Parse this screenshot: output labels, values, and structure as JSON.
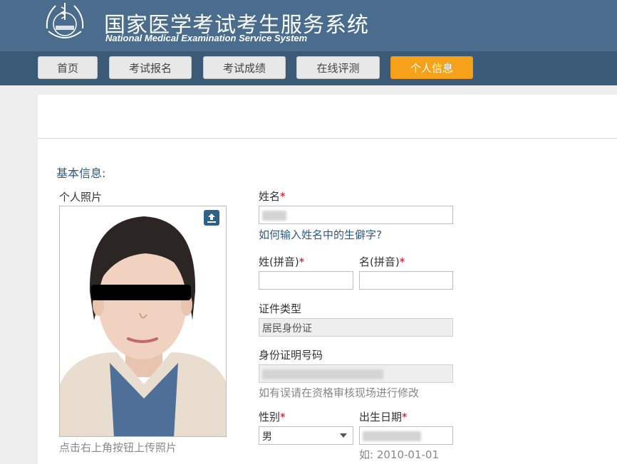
{
  "header": {
    "title_cn": "国家医学考试考生服务系统",
    "title_en": "National Medical Examination Service System"
  },
  "nav": {
    "items": [
      {
        "label": "首页"
      },
      {
        "label": "考试报名"
      },
      {
        "label": "考试成绩"
      },
      {
        "label": "在线评测"
      },
      {
        "label": "个人信息"
      }
    ],
    "active": "个人信息"
  },
  "form": {
    "section_title": "基本信息:",
    "photo": {
      "label": "个人照片",
      "hint": "点击右上角按钮上传照片"
    },
    "name": {
      "label": "姓名",
      "help_link": "如何输入姓名中的生僻字?"
    },
    "surname_pinyin": {
      "label": "姓(拼音)",
      "value": ""
    },
    "given_pinyin": {
      "label": "名(拼音)",
      "value": ""
    },
    "id_type": {
      "label": "证件类型",
      "value": "居民身份证"
    },
    "id_number": {
      "label": "身份证明号码",
      "hint": "如有误请在资格审核现场进行修改"
    },
    "gender": {
      "label": "性别",
      "value": "男"
    },
    "birth_date": {
      "label": "出生日期",
      "example": "如: 2010-01-01"
    },
    "required_mark": "*"
  },
  "colors": {
    "header_bg": "#4a6d8d",
    "nav_bg": "#3a5a78",
    "active_tab": "#f5a21a",
    "link": "#2f5a84",
    "required": "#d0021b"
  }
}
